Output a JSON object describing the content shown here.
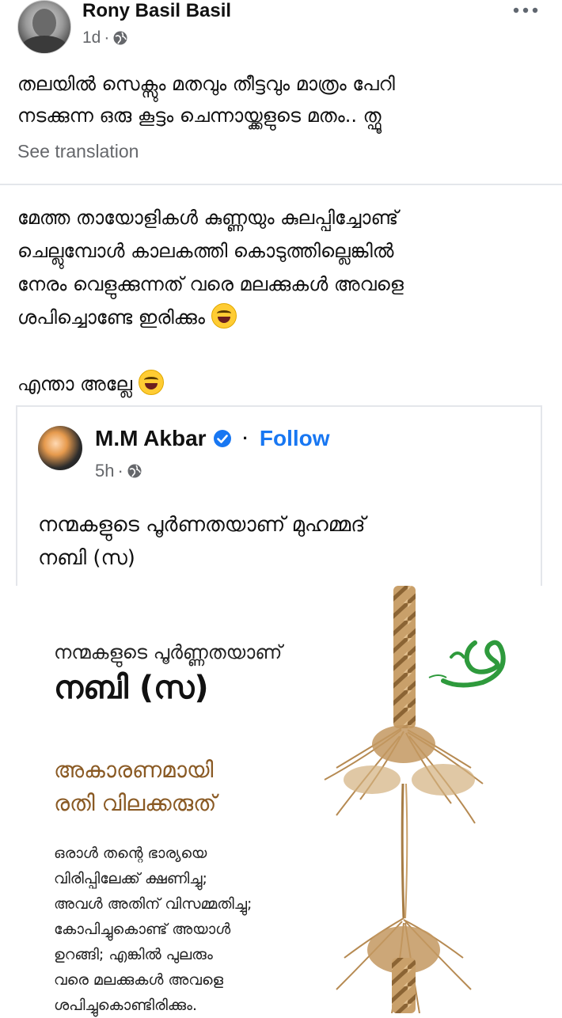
{
  "post": {
    "author": "Rony Basil Basil",
    "time": "1d",
    "meta_sep": "·",
    "text_line1": "തലയിൽ സെക്സും മതവും തീട്ടവും  മാത്രം പേറി",
    "text_line2": "നടക്കുന്ന ഒരു കൂട്ടം ചെന്നായ്ക്കളുടെ മതം.. ത്ഫൂ",
    "see_translation": "See translation"
  },
  "comment": {
    "line1": "മേത്ത തായോളികൾ കുണ്ണയും കുലപ്പിച്ചോണ്ട്",
    "line2": "ചെല്ലുമ്പോൾ കാലകത്തി കൊടുത്തില്ലെങ്കിൽ",
    "line3": "നേരം വെളുക്കുന്നത് വരെ മലക്കുകൾ അവളെ",
    "line4": "ശപിച്ചൊണ്ടേ ഇരിക്കും",
    "line5": "എന്താ അല്ലേ"
  },
  "shared": {
    "author": "M.M Akbar",
    "dot": "·",
    "follow": "Follow",
    "time": "5h",
    "meta_sep": "·",
    "text_line1": "നന്മകളുടെ പൂർണതയാണ് മുഹമ്മദ്",
    "text_line2": "നബി (സ)"
  },
  "poster": {
    "line1": "നന്മകളുടെ പൂർണ്ണതയാണ്",
    "line2": "നബി (സ)",
    "sub_line1": "അകാരണമായി",
    "sub_line2": "രതി വിലക്കരുത്",
    "body_line1": "ഒരാൾ തന്റെ ഭാര്യയെ",
    "body_line2": "വിരിപ്പിലേക്ക് ക്ഷണിച്ചു;",
    "body_line3": "അവൾ അതിന് വിസമ്മതിച്ചു;",
    "body_line4": "കോപിച്ചുകൊണ്ട് അയാൾ",
    "body_line5": "ഉറങ്ങി; എങ്കിൽ പുലരും",
    "body_line6": "വരെ മലക്കുകൾ അവളെ",
    "body_line7": "ശപിച്ചുകൊണ്ടിരിക്കും."
  },
  "icons": {
    "globe": "globe-icon",
    "more": "more-options-icon",
    "verified": "verified-badge-icon",
    "emoji": "laughing-emoji"
  },
  "colors": {
    "link": "#1877f2",
    "meta": "#65676b",
    "poster_sub": "#8a5a24"
  }
}
